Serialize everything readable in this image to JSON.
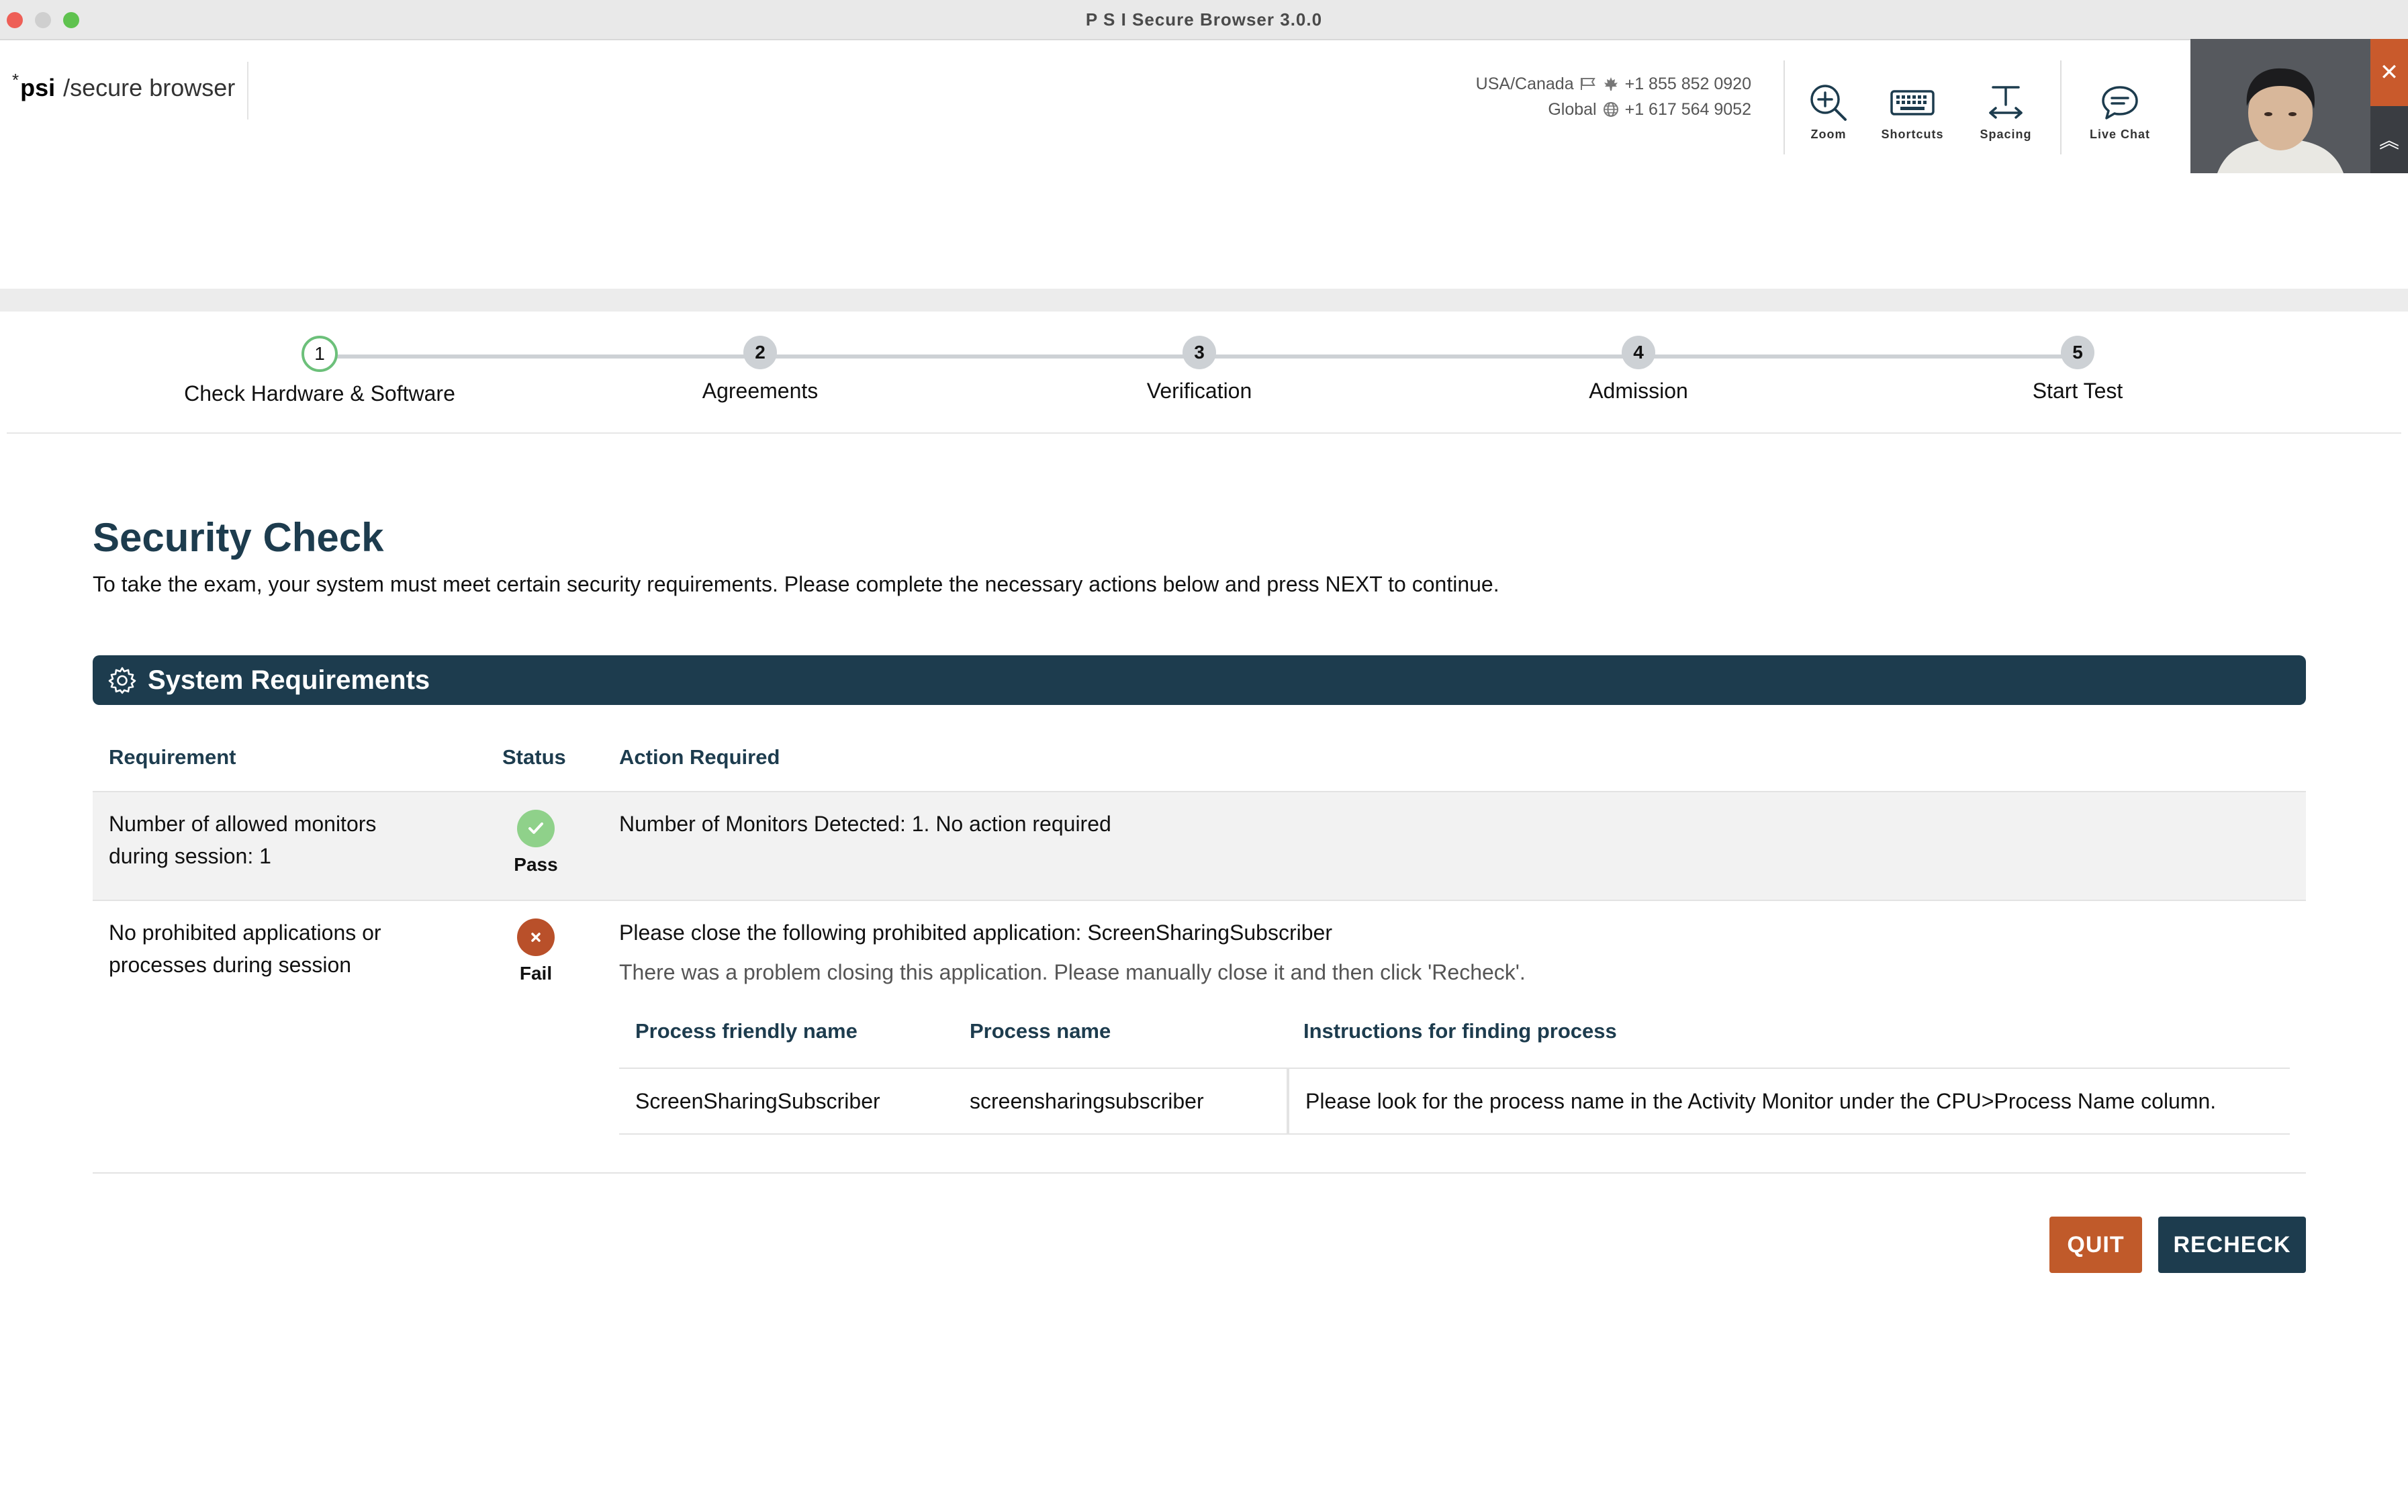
{
  "window": {
    "title": "P S I Secure Browser 3.0.0"
  },
  "header": {
    "logo_mark": "*",
    "logo_brand": "psi",
    "logo_product": "/secure browser",
    "contact": {
      "usa_label": "USA/Canada",
      "usa_phone": "+1 855 852 0920",
      "global_label": "Global",
      "global_phone": "+1 617 564 9052"
    },
    "tools": {
      "zoom": "Zoom",
      "shortcuts": "Shortcuts",
      "spacing": "Spacing",
      "live_chat": "Live Chat"
    },
    "camera": {
      "close": "✕",
      "collapse": "︽"
    }
  },
  "stepper": {
    "steps": [
      {
        "num": "1",
        "label": "Check Hardware & Software"
      },
      {
        "num": "2",
        "label": "Agreements"
      },
      {
        "num": "3",
        "label": "Verification"
      },
      {
        "num": "4",
        "label": "Admission"
      },
      {
        "num": "5",
        "label": "Start Test"
      }
    ],
    "active_index": 0
  },
  "main": {
    "title": "Security Check",
    "subtitle": "To take the exam, your system must meet certain security requirements. Please complete the necessary actions below and press NEXT to continue.",
    "section_title": "System Requirements",
    "table": {
      "headers": {
        "requirement": "Requirement",
        "status": "Status",
        "action": "Action Required"
      },
      "rows": [
        {
          "requirement_line1": "Number of allowed monitors",
          "requirement_line2": "during session: 1",
          "status": "Pass",
          "action": "Number of Monitors Detected: 1. No action required"
        },
        {
          "requirement_line1": "No prohibited applications or",
          "requirement_line2": "processes during session",
          "status": "Fail",
          "action": "Please close the following prohibited application: ScreenSharingSubscriber",
          "note": "There was a problem closing this application. Please manually close it and then click 'Recheck'.",
          "process_table": {
            "headers": {
              "friendly": "Process friendly name",
              "name": "Process name",
              "instructions": "Instructions for finding process"
            },
            "rows": [
              {
                "friendly": "ScreenSharingSubscriber",
                "name": "screensharingsubscriber",
                "instructions": "Please look for the process name in the Activity Monitor under the CPU>Process Name column."
              }
            ]
          }
        }
      ]
    },
    "buttons": {
      "quit": "QUIT",
      "recheck": "RECHECK"
    }
  },
  "colors": {
    "navy": "#1d3c4e",
    "quit": "#c05a2a",
    "pass": "#8fd18a",
    "fail": "#b9502a",
    "active_step": "#6cc07a"
  }
}
